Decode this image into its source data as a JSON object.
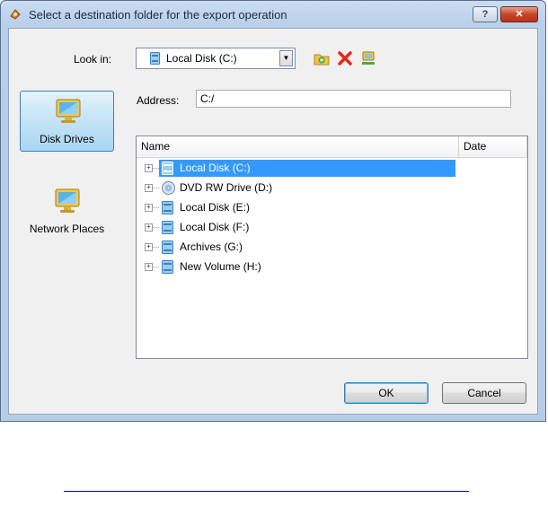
{
  "dialog": {
    "title": "Select a destination folder for the export operation",
    "help_label": "?",
    "close_label": "✕"
  },
  "look_in": {
    "label": "Look in:",
    "value": "Local Disk (C:)",
    "arrow": "▼"
  },
  "toolbar": {
    "icons": [
      "new-folder-icon",
      "delete-icon",
      "network-drive-icon"
    ]
  },
  "address": {
    "label": "Address:",
    "value": "C:/"
  },
  "places": [
    {
      "label": "Disk Drives",
      "selected": true
    },
    {
      "label": "Network Places",
      "selected": false
    }
  ],
  "list": {
    "columns": [
      "Name",
      "Date"
    ],
    "items": [
      {
        "label": "Local Disk (C:)",
        "icon": "hard-disk-icon",
        "selected": true
      },
      {
        "label": "DVD RW Drive (D:)",
        "icon": "dvd-drive-icon",
        "selected": false
      },
      {
        "label": "Local Disk (E:)",
        "icon": "hard-disk-icon",
        "selected": false
      },
      {
        "label": "Local Disk (F:)",
        "icon": "hard-disk-icon",
        "selected": false
      },
      {
        "label": "Archives (G:)",
        "icon": "hard-disk-icon",
        "selected": false
      },
      {
        "label": "New Volume (H:)",
        "icon": "hard-disk-icon",
        "selected": false
      }
    ]
  },
  "buttons": {
    "ok": "OK",
    "cancel": "Cancel"
  },
  "colors": {
    "selection": "#3399ff",
    "title_gradient": "#c9dcf2",
    "close_button": "#c7452a"
  }
}
